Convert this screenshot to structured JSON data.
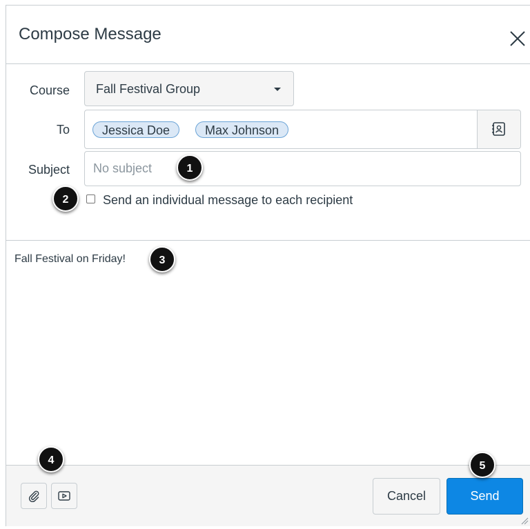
{
  "dialog": {
    "title": "Compose Message",
    "close_icon": "close-icon"
  },
  "form": {
    "course_label": "Course",
    "course_value": "Fall Festival Group",
    "to_label": "To",
    "recipients": [
      "Jessica Doe",
      "Max Johnson"
    ],
    "address_book_icon": "address-book-icon",
    "subject_label": "Subject",
    "subject_placeholder": "No subject",
    "subject_value": "",
    "individual_message_label": "Send an individual message to each recipient",
    "individual_message_checked": false
  },
  "message": {
    "body": "Fall Festival on Friday!"
  },
  "footer": {
    "attach_icon": "paperclip-icon",
    "media_icon": "media-icon",
    "cancel_label": "Cancel",
    "send_label": "Send"
  },
  "callouts": [
    "1",
    "2",
    "3",
    "4",
    "5"
  ],
  "colors": {
    "send_button": "#0d87e4",
    "token_bg": "#dbe8f6",
    "token_border": "#6aa3d6",
    "callout": "#111111"
  }
}
